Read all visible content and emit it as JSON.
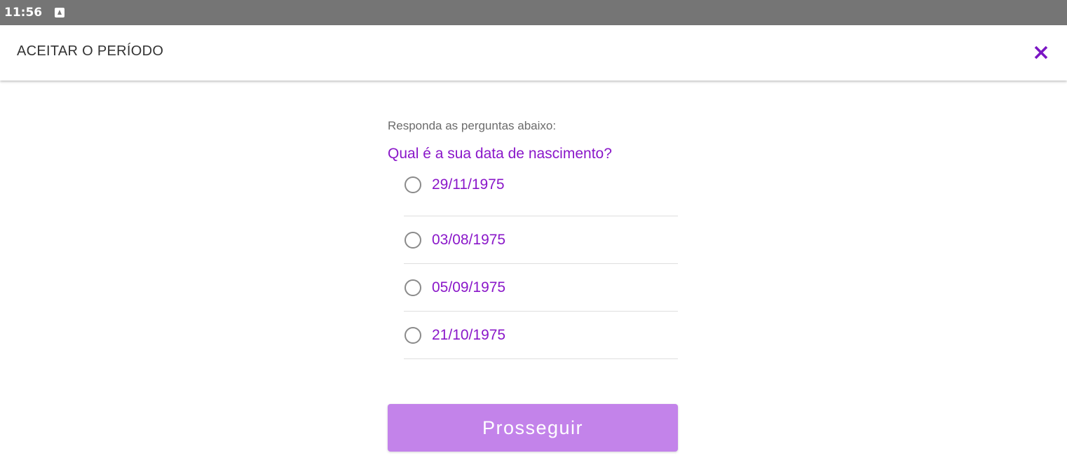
{
  "status_bar": {
    "time": "11:56",
    "notification_icon": "notification-icon"
  },
  "app_bar": {
    "title": "ACEITAR O PERÍODO",
    "close_icon": "close-icon",
    "accent_color": "#7b16c4"
  },
  "form": {
    "instruction": "Responda as perguntas abaixo:",
    "question": "Qual é a sua data de nascimento?",
    "options": [
      {
        "label": "29/11/1975",
        "selected": false
      },
      {
        "label": "03/08/1975",
        "selected": false
      },
      {
        "label": "05/09/1975",
        "selected": false
      },
      {
        "label": "21/10/1975",
        "selected": false
      }
    ],
    "submit_label": "Prosseguir",
    "submit_color": "#c383ea"
  }
}
